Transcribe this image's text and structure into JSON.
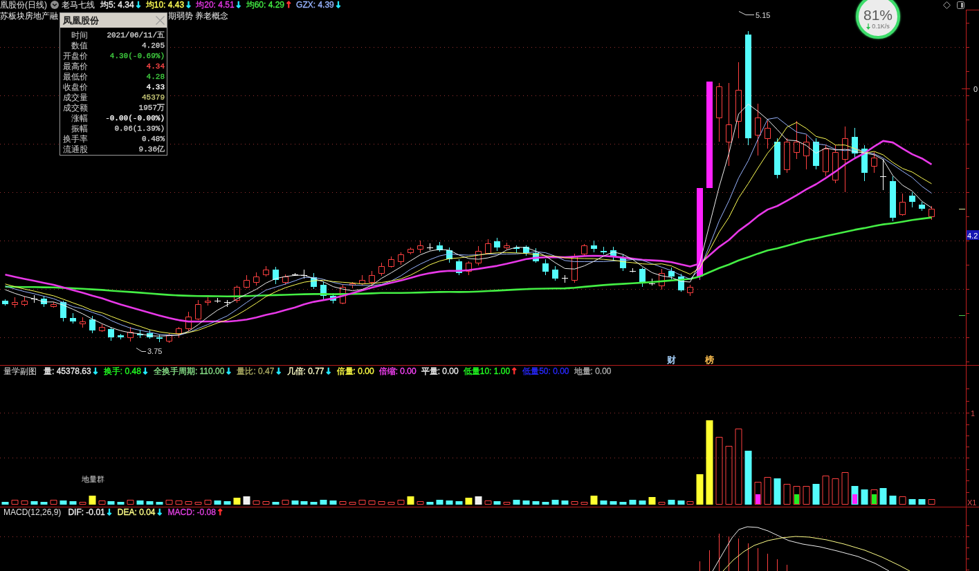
{
  "header": {
    "title": "凰股份(日线)",
    "indicator": "老马七线",
    "averages": [
      {
        "label": "均5: 4.34",
        "arrow": {
          "glyph": "↓",
          "color": "#22e8ff"
        },
        "color": "#f0f0f0"
      },
      {
        "label": "均10: 4.43",
        "arrow": {
          "glyph": "↓",
          "color": "#22e8ff"
        },
        "color": "#ffff55"
      },
      {
        "label": "均20: 4.51",
        "arrow": {
          "glyph": "↓",
          "color": "#22e8ff"
        },
        "color": "#e838e8"
      },
      {
        "label": "均60: 4.29",
        "arrow": {
          "glyph": "↑",
          "color": "#ff3030"
        },
        "color": "#44ee44"
      },
      {
        "label": "GZX: 4.39",
        "arrow": {
          "glyph": "↓",
          "color": "#22e8ff"
        },
        "color": "#98b4ff"
      }
    ]
  },
  "widget": {
    "percent": "81%",
    "speed": "0.1K/s"
  },
  "concepts": {
    "left": "苏板块房地产融",
    "right": "期弱势 养老概念"
  },
  "popup": {
    "title": "凤凰股份",
    "rows": [
      {
        "label": "时间",
        "value": "2021/06/11/五",
        "color": "#d0d0d0"
      },
      {
        "label": "数值",
        "value": "4.205",
        "color": "#d0d0d0"
      },
      {
        "label": "开盘价",
        "value": "4.30(-0.69%)",
        "color": "#40d040"
      },
      {
        "label": "最高价",
        "value": "4.34",
        "color": "#ff4848"
      },
      {
        "label": "最低价",
        "value": "4.28",
        "color": "#40d040"
      },
      {
        "label": "收盘价",
        "value": "4.33",
        "color": "#ffffff"
      },
      {
        "label": "成交量",
        "value": "45379",
        "color": "#c8c878"
      },
      {
        "label": "成交额",
        "value": "1957万",
        "color": "#d0d0d0"
      },
      {
        "label": "涨幅",
        "value": "-0.00(-0.00%)",
        "color": "#ffffff"
      },
      {
        "label": "振幅",
        "value": "0.06(1.39%)",
        "color": "#d0d0d0"
      },
      {
        "label": "换手率",
        "value": "0.48%",
        "color": "#d0d0d0"
      },
      {
        "label": "流通股",
        "value": "9.36亿",
        "color": "#d0d0d0"
      }
    ]
  },
  "price_chart": {
    "axis_label": "0",
    "current_price": "4.2",
    "high_label": "5.15",
    "low_label": "3.75",
    "events": [
      {
        "label": "财",
        "color": "#a8d4ff"
      },
      {
        "label": "榜",
        "color": "#ffc050"
      }
    ]
  },
  "volume_panel": {
    "title": "量学副图",
    "items": [
      {
        "label": "量: 45378.63",
        "arrow": {
          "glyph": "↓",
          "color": "#22e8ff"
        },
        "color": "#e8e8e8"
      },
      {
        "label": "换手: 0.48",
        "arrow": {
          "glyph": "↓",
          "color": "#22e8ff"
        },
        "color": "#22ff22"
      },
      {
        "label": "全换手周期: 110.00",
        "arrow": {
          "glyph": "↓",
          "color": "#22e8ff"
        },
        "color": "#88e088"
      },
      {
        "label": "量比: 0.47",
        "arrow": {
          "glyph": "↓",
          "color": "#22e8ff"
        },
        "color": "#a8a860"
      },
      {
        "label": "几倍: 0.77",
        "arrow": {
          "glyph": "↓",
          "color": "#22e8ff"
        },
        "color": "#ffffc8"
      },
      {
        "label": "倍量: 0.00",
        "color": "#ffff44"
      },
      {
        "label": "倍缩: 0.00",
        "color": "#ff44ff"
      },
      {
        "label": "平量: 0.00",
        "color": "#e8e8e8"
      },
      {
        "label": "低量10: 1.00",
        "arrow": {
          "glyph": "↑",
          "color": "#ff3030"
        },
        "color": "#22ff22"
      },
      {
        "label": "低量50: 0.00",
        "color": "#2828ff"
      },
      {
        "label": "地量: 0.00",
        "color": "#a8a8a8"
      }
    ],
    "annotation": "地量群",
    "axis_labels": [
      "1",
      "X1"
    ]
  },
  "macd_panel": {
    "title": "MACD(12,26,9)",
    "items": [
      {
        "label": "DIF: -0.01",
        "arrow": {
          "glyph": "↓",
          "color": "#22e8ff"
        },
        "color": "#f0f0f0"
      },
      {
        "label": "DEA: 0.04",
        "arrow": {
          "glyph": "↓",
          "color": "#22e8ff"
        },
        "color": "#ffff88"
      },
      {
        "label": "MACD: -0.08",
        "arrow": {
          "glyph": "↑",
          "color": "#ff3030"
        },
        "color": "#e040e0"
      }
    ]
  }
}
